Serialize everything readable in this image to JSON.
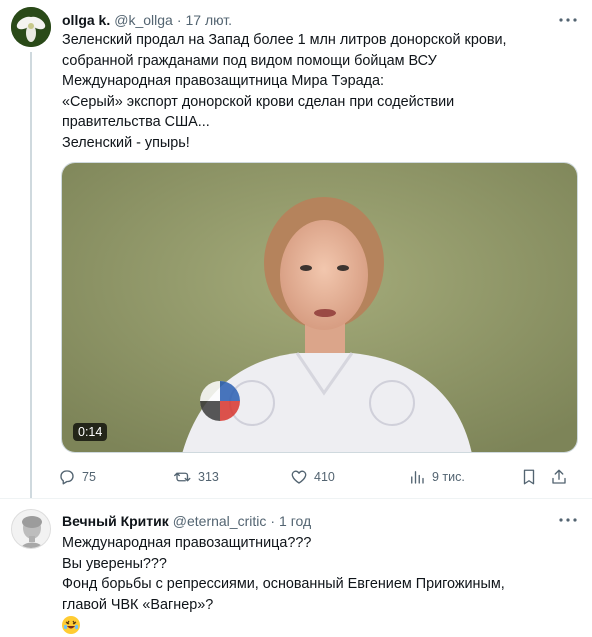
{
  "tweet1": {
    "author_name": "ollga k.",
    "author_handle": "@k_ollga",
    "separator": "·",
    "time": "17 лют.",
    "text_lines": [
      "Зеленский продал на Запад более 1 млн литров донорской крови,",
      "собранной гражданами под видом помощи бойцам ВСУ",
      "Международная правозащитница Мира Тэрада:",
      "«Серый» экспорт донорской крови сделан при содействии",
      "правительства США...",
      "Зеленский - упырь!"
    ],
    "video_duration": "0:14",
    "stats": {
      "replies": "75",
      "retweets": "313",
      "likes": "410",
      "views": "9 тис."
    }
  },
  "tweet2": {
    "author_name": "Вечный Критик",
    "author_handle": "@eternal_critic",
    "separator": "·",
    "time": "1 год",
    "text_lines": [
      "Международная правозащитница???",
      "Вы уверены???",
      "Фонд борьбы с репрессиями, основанный Евгением Пригожиным,",
      "главой ЧВК «Вагнер»?"
    ],
    "emoji": "rofl-emoji"
  },
  "icons": {
    "reply": "reply-icon",
    "retweet": "retweet-icon",
    "like": "heart-icon",
    "views": "views-bar-icon",
    "bookmark": "bookmark-icon",
    "share": "share-icon",
    "more": "more-dots-icon"
  },
  "colors": {
    "text_primary": "#0f1419",
    "text_secondary": "#536471",
    "border": "#cfd9de"
  }
}
